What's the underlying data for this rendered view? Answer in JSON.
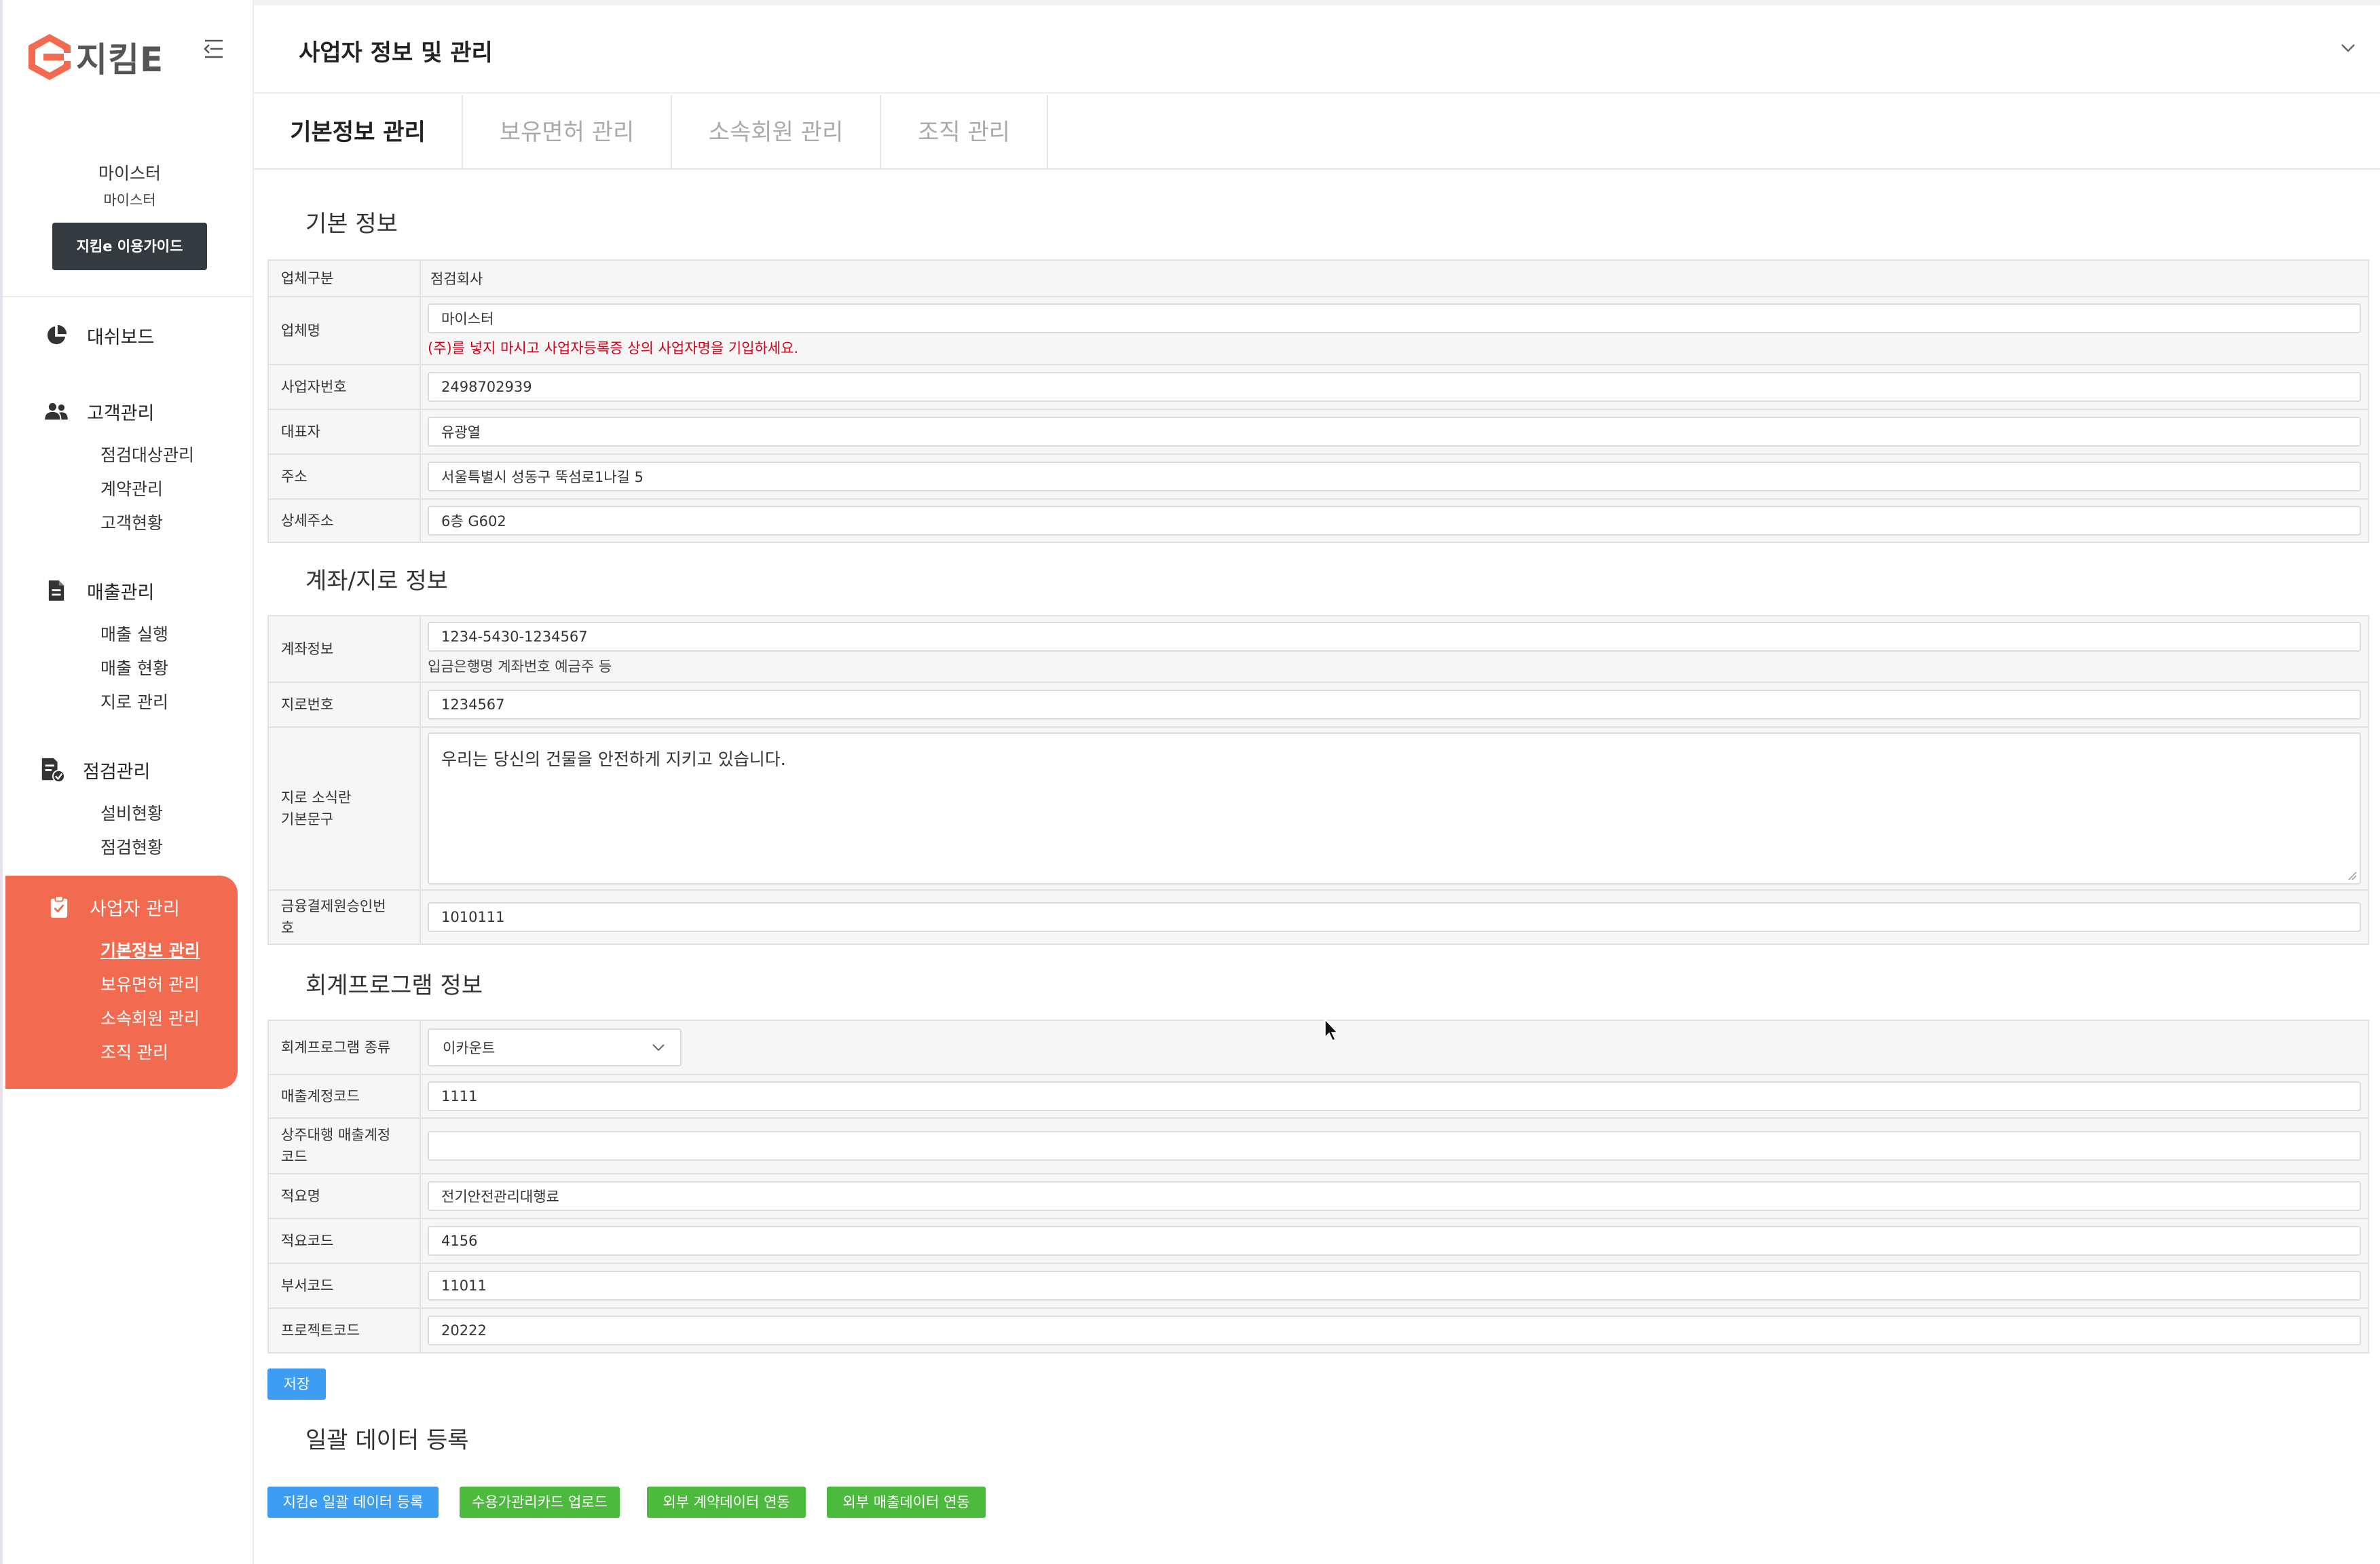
{
  "brand": {
    "name": "지킴E",
    "accent": "#f26a4f"
  },
  "user": {
    "name": "마이스터",
    "company": "마이스터",
    "guide_button": "지킴e 이용가이드"
  },
  "menu": {
    "dashboard": "대쉬보드",
    "customer": {
      "label": "고객관리",
      "items": [
        "점검대상관리",
        "계약관리",
        "고객현황"
      ]
    },
    "sales": {
      "label": "매출관리",
      "items": [
        "매출 실행",
        "매출 현황",
        "지로 관리"
      ]
    },
    "inspection": {
      "label": "점검관리",
      "items": [
        "설비현황",
        "점검현황"
      ]
    },
    "business": {
      "label": "사업자 관리",
      "items": [
        "기본정보 관리",
        "보유면허 관리",
        "소속회원 관리",
        "조직 관리"
      ]
    }
  },
  "page": {
    "title": "사업자 정보 및 관리",
    "tabs": [
      "기본정보 관리",
      "보유면허 관리",
      "소속회원 관리",
      "조직 관리"
    ]
  },
  "basic_info": {
    "title": "기본 정보",
    "company_type_label": "업체구분",
    "company_type_value": "점검회사",
    "company_name_label": "업체명",
    "company_name_value": "마이스터",
    "company_name_help": "(주)를 넣지 마시고 사업자등록증 상의 사업자명을 기입하세요.",
    "biz_no_label": "사업자번호",
    "biz_no_value": "2498702939",
    "ceo_label": "대표자",
    "ceo_value": "유광열",
    "address_label": "주소",
    "address_value": "서울특별시 성동구 뚝섬로1나길 5",
    "detail_address_label": "상세주소",
    "detail_address_value": "6층 G602"
  },
  "account_info": {
    "title": "계좌/지로 정보",
    "account_label": "계좌정보",
    "account_value": "1234-5430-1234567",
    "account_help": "입금은행명 계좌번호 예금주 등",
    "giro_label": "지로번호",
    "giro_value": "1234567",
    "giro_msg_label_1": "지로 소식란",
    "giro_msg_label_2": "기본문구",
    "giro_msg_value": "우리는 당신의 건물을 안전하게 지키고 있습니다.",
    "fin_label_1": "금융결제원승인번",
    "fin_label_2": "호",
    "fin_value": "1010111"
  },
  "accounting_info": {
    "title": "회계프로그램 정보",
    "program_label": "회계프로그램 종류",
    "program_value": "이카운트",
    "sales_code_label": "매출계정코드",
    "sales_code_value": "1111",
    "resident_label_1": "상주대행 매출계정",
    "resident_label_2": "코드",
    "resident_value": "",
    "summary_label": "적요명",
    "summary_value": "전기안전관리대행료",
    "summary_code_label": "적요코드",
    "summary_code_value": "4156",
    "dept_code_label": "부서코드",
    "dept_code_value": "11011",
    "project_code_label": "프로젝트코드",
    "project_code_value": "20222"
  },
  "save_button": "저장",
  "bulk": {
    "title": "일괄 데이터 등록",
    "buttons": [
      "지킴e 일괄 데이터 등록",
      "수용가관리카드 업로드",
      "외부 계약데이터 연동",
      "외부 매출데이터 연동"
    ]
  }
}
